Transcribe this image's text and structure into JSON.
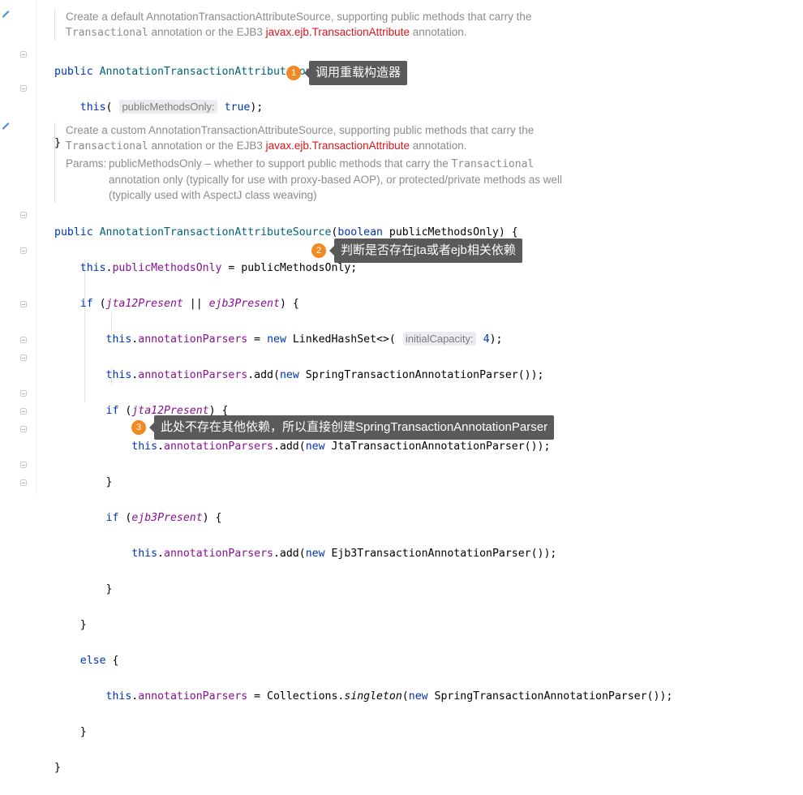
{
  "doc1": {
    "line1": "Create a default AnnotationTransactionAttributeSource, supporting public methods that carry the",
    "code_transactional": "Transactional",
    "mid": " annotation or the EJB3 ",
    "link": "javax.ejb.TransactionAttribute",
    "tail": " annotation."
  },
  "doc2": {
    "line1": "Create a custom AnnotationTransactionAttributeSource, supporting public methods that carry the",
    "code_transactional": "Transactional",
    "mid": " annotation or the EJB3 ",
    "link": "javax.ejb.TransactionAttribute",
    "tail": " annotation.",
    "params_label": "Params:",
    "params_text_a": "publicMethodsOnly – whether to support public methods that carry the ",
    "params_code": "Transactional",
    "params_text_b": " annotation only (typically for use with proxy-based AOP), or protected/private methods as well (typically used with AspectJ class weaving)"
  },
  "code": {
    "kw_public": "public",
    "ctor_name": "AnnotationTransactionAttributeSource",
    "paren_open_brace": "() {",
    "kw_this": "this",
    "paren_open": "(",
    "hint_public_methods_only": "publicMethodsOnly:",
    "kw_true": "true",
    "close_semicolon": ");",
    "brace_close": "}",
    "kw_boolean": "boolean",
    "param_name": " publicMethodsOnly",
    "close_brace_open": ") {",
    "assign_field": "publicMethodsOnly",
    "assign_rhs": " = publicMethodsOnly;",
    "kw_if": "if",
    "jta_present": "jta12Present",
    "or_op": " || ",
    "ejb3_present": "ejb3Present",
    "field_parsers": "annotationParsers",
    "kw_new": "new",
    "linked_hash_set": " LinkedHashSet<>(",
    "hint_initial_capacity": "initialCapacity:",
    "num_four": "4",
    "add_call": ".add(",
    "spring_parser": " SpringTransactionAnnotationParser());",
    "jta_parser": " JtaTransactionAnnotationParser());",
    "ejb3_parser": " Ejb3TransactionAnnotationParser());",
    "kw_else": "else",
    "collections": " = Collections.",
    "singleton": "singleton",
    "spring_parser_singleton": " SpringTransactionAnnotationParser());"
  },
  "callouts": [
    {
      "num": "1",
      "text": "调用重载构造器"
    },
    {
      "num": "2",
      "text": "判断是否存在jta或者ejb相关依赖"
    },
    {
      "num": "3",
      "text": "此处不存在其他依赖，所以直接创建SpringTransactionAnnotationParser"
    }
  ],
  "icons": [
    "pencil-icon",
    "fold-marker-icon"
  ]
}
